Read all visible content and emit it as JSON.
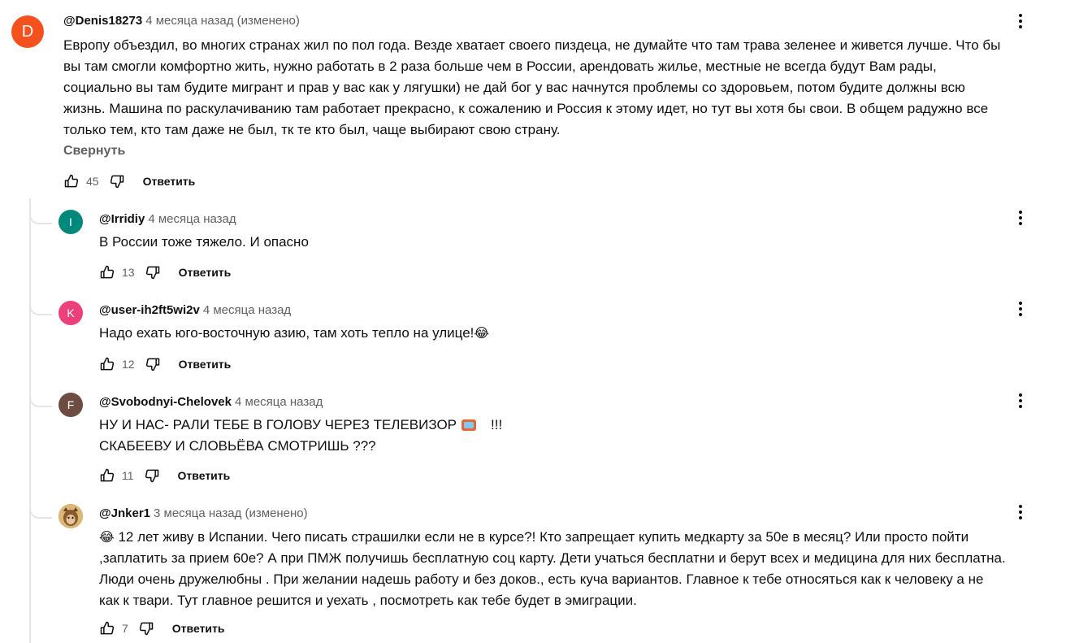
{
  "comments": [
    {
      "author": "@Denis18273",
      "time": "4 месяца назад (изменено)",
      "avatar_letter": "D",
      "avatar_color": "#f4511e",
      "lines": [
        "Европу объездил, во многих странах жил по пол года. Везде хватает своего пиздеца, не думайте что там трава зеленее и живется лучше. Что бы",
        "вы там смогли комфортно жить, нужно работать в 2 раза больше чем в России, арендовать жилье, местные не всегда будут Вам рады,",
        "социально вы там будите мигрант и прав у вас как у лягушки) не дай бог у вас начнутся проблемы со здоровьем, потом будите должны всю",
        "жизнь. Машина по раскулачиванию там работает прекрасно, к сожалению и Россия к этому идет, но тут вы хотя бы свои. В общем радужно все",
        "только тем, кто там даже не был, тк те кто был, чаще выбирают свою страну."
      ],
      "collapse_label": "Свернуть",
      "likes": "45",
      "reply_label": "Ответить"
    },
    {
      "author": "@Irridiy",
      "time": "4 месяца назад",
      "avatar_letter": "I",
      "avatar_color": "#00897b",
      "lines": [
        "В России тоже тяжело. И опасно"
      ],
      "likes": "13",
      "reply_label": "Ответить"
    },
    {
      "author": "@user-ih2ft5wi2v",
      "time": "4 месяца назад",
      "avatar_letter": "K",
      "avatar_color": "#ec407a",
      "lines": [
        "Надо ехать юго-восточную азию, там хоть тепло на улице!"
      ],
      "emoji": "😂",
      "likes": "12",
      "reply_label": "Ответить"
    },
    {
      "author": "@Svobodnyi-Chelovek",
      "time": "4 месяца назад",
      "avatar_letter": "F",
      "avatar_color": "#6d4c41",
      "line1": "НУ И НАС- РАЛИ ТЕБЕ В ГОЛОВУ ЧЕРЕЗ ТЕЛЕВИЗОР",
      "line1_tail": "!!!",
      "line2": "СКАБЕЕВУ И СЛОВЬЁВА СМОТРИШЬ ???",
      "likes": "11",
      "reply_label": "Ответить"
    },
    {
      "author": "@Jnker1",
      "time": "3 месяца назад (изменено)",
      "avatar_color": "#c8a25a",
      "emoji": "😂",
      "lines": [
        "12 лет живу в Испании. Чего писать страшилки если не в курсе?! Кто запрещает купить медкарту за 50е в месяц? Или просто пойти",
        ",заплатить за прием 60е? А при ПМЖ получишь бесплатную соц карту. Дети учаться бесплатни и берут всех и медицина для них бесплатна.",
        "Люди очень дружелюбны . При желании надешь работу и без доков., есть куча вариантов. Главное к тебе относяться как к человеку а не",
        "как к твари. Тут главное решится и уехать , посмотреть как тебе будет в эмиграции."
      ],
      "likes": "7",
      "reply_label": "Ответить"
    }
  ]
}
